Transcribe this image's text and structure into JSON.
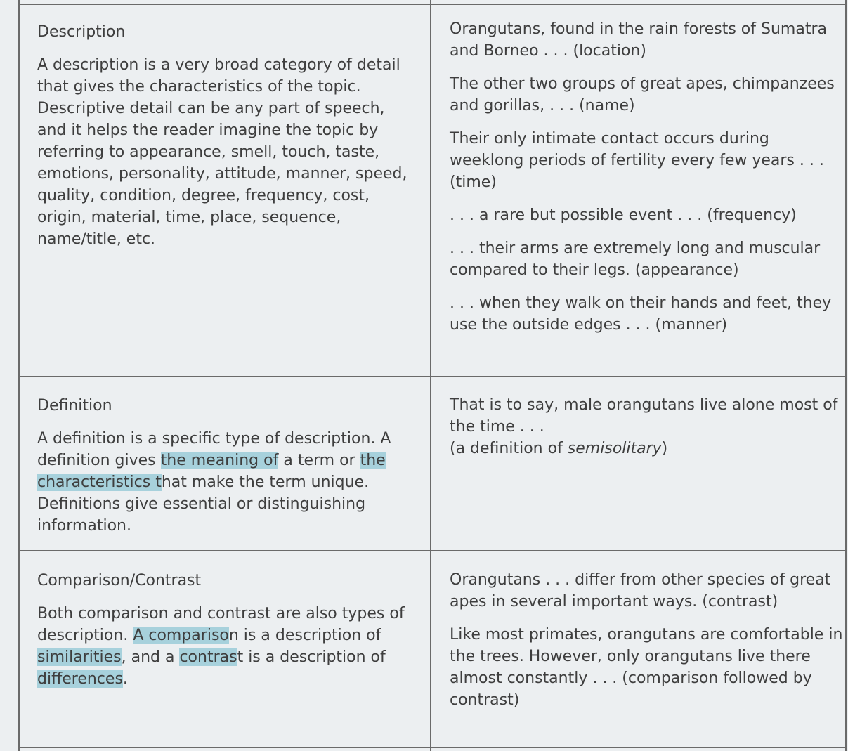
{
  "rows": [
    {
      "heading": "Description",
      "body": "A description is a very broad category of detail that gives the characteristics of the topic. Descriptive detail can be any part of speech, and it helps the reader imagine the topic by referring to appearance, smell, touch, taste, emotions, personality, attitude, manner, speed, quality, condition, degree, frequency, cost, origin, material, time, place, sequence, name/title, etc.",
      "examples": [
        "Orangutans, found in the rain forests of Sumatra and Borneo . . . (location)",
        "The other two groups of great apes, chimpanzees and gorillas, . . . (name)",
        "Their only intimate contact occurs during weeklong periods of fertility every few years . . . (time)",
        ". . . a rare but possible event . . . (frequency)",
        ". . . their arms are extremely long and muscular compared to their legs. (appearance)",
        ". . . when they walk on their hands and feet, they use the outside edges . . . (manner)"
      ]
    },
    {
      "heading": "Definition",
      "body_parts": [
        "A definition is a specific type of description. A definition gives ",
        "the meaning of",
        " a term or ",
        "the characteristics t",
        "hat make the term unique. Definitions give essential or distinguishing information."
      ],
      "example_line1": "That is to say, male orangutans live alone most of the time . . .",
      "example_line2_prefix": "(a definition of ",
      "example_line2_italic": "semisolitary",
      "example_line2_suffix": ")"
    },
    {
      "heading": "Comparison/Contrast",
      "body_parts": [
        "Both comparison and contrast are also types of description. ",
        "A compariso",
        "n is a description of ",
        "similarities",
        ", and a ",
        "contras",
        "t is a description of ",
        "differences",
        "."
      ],
      "examples": [
        "Orangutans . . . differ from other species of great apes in several important ways. (contrast)",
        "Like most primates, orangutans are comfortable in the trees. However, only orangutans live there almost constantly . . . (comparison followed by contrast)"
      ]
    }
  ]
}
